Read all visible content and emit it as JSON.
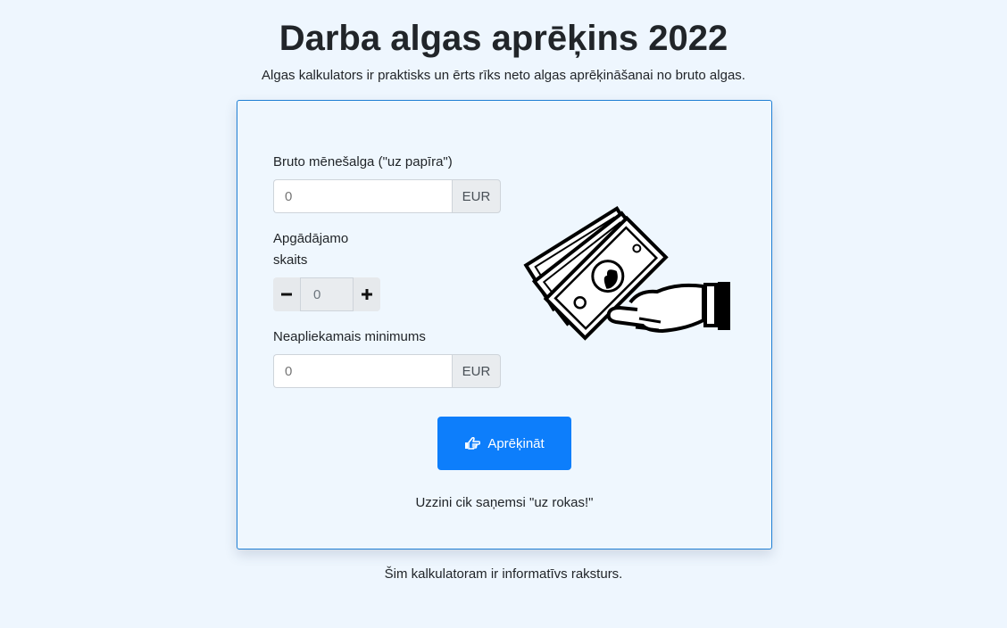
{
  "header": {
    "title": "Darba algas aprēķins 2022",
    "subtitle": "Algas kalkulators ir praktisks un ērts rīks neto algas aprēķināšanai no bruto algas."
  },
  "form": {
    "gross_salary": {
      "label": "Bruto mēnešalga (\"uz papīra\")",
      "placeholder": "0",
      "currency": "EUR"
    },
    "dependents": {
      "label_line1": "Apgādājamo",
      "label_line2": "skaits",
      "value": "0",
      "minus_icon": "minus-icon",
      "plus_icon": "plus-icon"
    },
    "non_taxable_minimum": {
      "label": "Neapliekamais minimums",
      "placeholder": "0",
      "currency": "EUR"
    },
    "submit": {
      "label": "Aprēķināt",
      "icon": "hand-pointing-icon"
    },
    "hint": "Uzzini cik saņemsi \"uz rokas!\""
  },
  "illustration": {
    "icon": "hand-holding-money-icon"
  },
  "footer": {
    "note": "Šim kalkulatoram ir informatīvs raksturs."
  },
  "colors": {
    "background": "#eef6fe",
    "card_border": "#1f7fd4",
    "primary": "#0d7efb",
    "addon": "#e9ecef"
  }
}
